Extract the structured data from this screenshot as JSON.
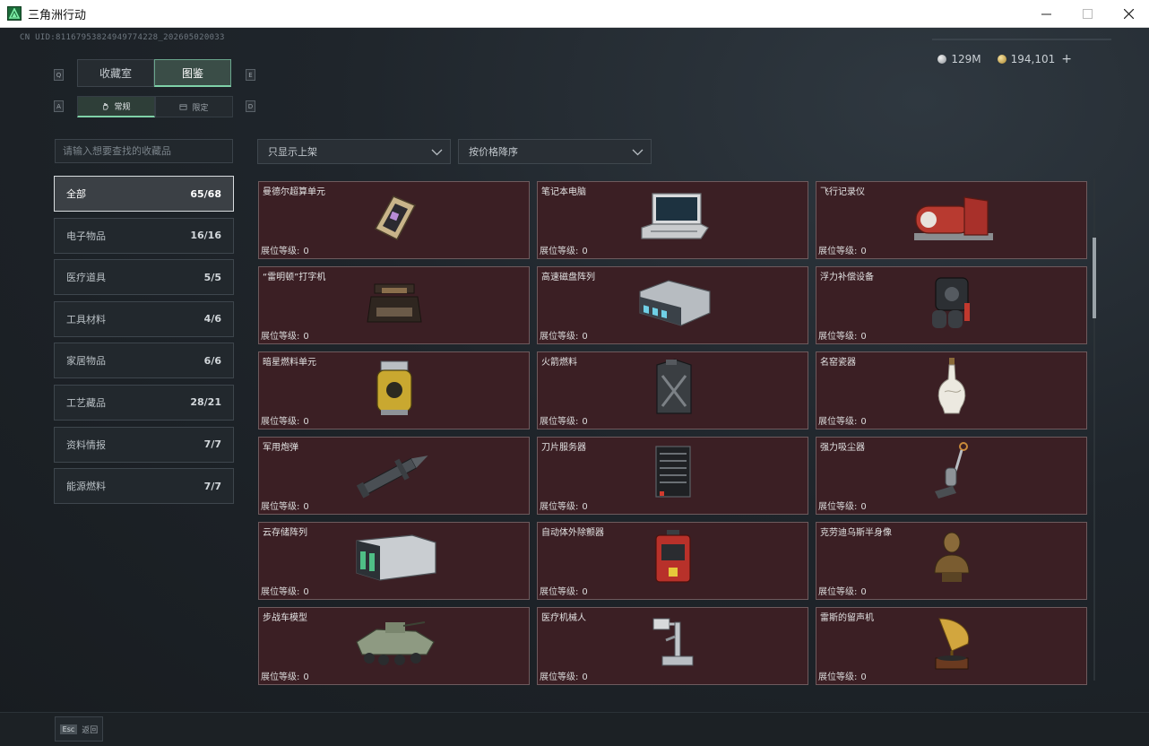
{
  "window": {
    "title": "三角洲行动",
    "icon": "delta-logo-icon",
    "controls": [
      "minimize-icon",
      "maximize-icon",
      "close-icon"
    ]
  },
  "header": {
    "uid": "CN UID:811679538249497742​28_202605020033",
    "currency": [
      {
        "icon": "silver-coin-icon",
        "value": "129M"
      },
      {
        "icon": "gold-coin-icon",
        "value": "194,101"
      }
    ],
    "add_symbol": "+"
  },
  "tabs": {
    "key_prev": "Q",
    "key_next": "E",
    "items": [
      {
        "label": "收藏室",
        "active": false
      },
      {
        "label": "图鉴",
        "active": true
      }
    ]
  },
  "subtabs": {
    "key_prev": "A",
    "key_next": "D",
    "items": [
      {
        "label": "常规",
        "icon": "hand-icon",
        "active": true
      },
      {
        "label": "限定",
        "icon": "limited-icon",
        "active": false
      }
    ]
  },
  "search": {
    "placeholder": "请输入想要查找的收藏品",
    "value": ""
  },
  "filters": {
    "shelf": "只显示上架",
    "sort": "按价格降序"
  },
  "categories": [
    {
      "label": "全部",
      "count": "65/68",
      "active": true
    },
    {
      "label": "电子物品",
      "count": "16/16"
    },
    {
      "label": "医疗道具",
      "count": "5/5"
    },
    {
      "label": "工具材料",
      "count": "4/6"
    },
    {
      "label": "家居物品",
      "count": "6/6"
    },
    {
      "label": "工艺藏品",
      "count": "28/21"
    },
    {
      "label": "资料情报",
      "count": "7/7"
    },
    {
      "label": "能源燃料",
      "count": "7/7"
    }
  ],
  "level_label": "展位等级:",
  "items": [
    {
      "name": "曼德尔超算单元",
      "level": "0",
      "icon": "supercomputer-chip-icon"
    },
    {
      "name": "笔记本电脑",
      "level": "0",
      "icon": "laptop-icon"
    },
    {
      "name": "飞行记录仪",
      "level": "0",
      "icon": "flight-recorder-icon"
    },
    {
      "name": "“雷明顿”打字机",
      "level": "0",
      "icon": "typewriter-icon"
    },
    {
      "name": "高速磁盘阵列",
      "level": "0",
      "icon": "disk-array-icon"
    },
    {
      "name": "浮力补偿设备",
      "level": "0",
      "icon": "buoyancy-device-icon"
    },
    {
      "name": "暗星燃料单元",
      "level": "0",
      "icon": "fuel-cell-icon"
    },
    {
      "name": "火箭燃料",
      "level": "0",
      "icon": "jerry-can-icon"
    },
    {
      "name": "名窑瓷器",
      "level": "0",
      "icon": "porcelain-vase-icon"
    },
    {
      "name": "军用炮弹",
      "level": "0",
      "icon": "artillery-shell-icon"
    },
    {
      "name": "刀片服务器",
      "level": "0",
      "icon": "blade-server-icon"
    },
    {
      "name": "强力吸尘器",
      "level": "0",
      "icon": "vacuum-cleaner-icon"
    },
    {
      "name": "云存储阵列",
      "level": "0",
      "icon": "cloud-storage-icon"
    },
    {
      "name": "自动体外除颤器",
      "level": "0",
      "icon": "defibrillator-icon"
    },
    {
      "name": "克劳迪乌斯半身像",
      "level": "0",
      "icon": "bust-statue-icon"
    },
    {
      "name": "步战车模型",
      "level": "0",
      "icon": "ifv-model-icon"
    },
    {
      "name": "医疗机械人",
      "level": "0",
      "icon": "medical-robot-icon"
    },
    {
      "name": "雷斯的留声机",
      "level": "0",
      "icon": "gramophone-icon"
    }
  ],
  "footer": {
    "esc_key": "Esc",
    "back_label": "返回"
  }
}
